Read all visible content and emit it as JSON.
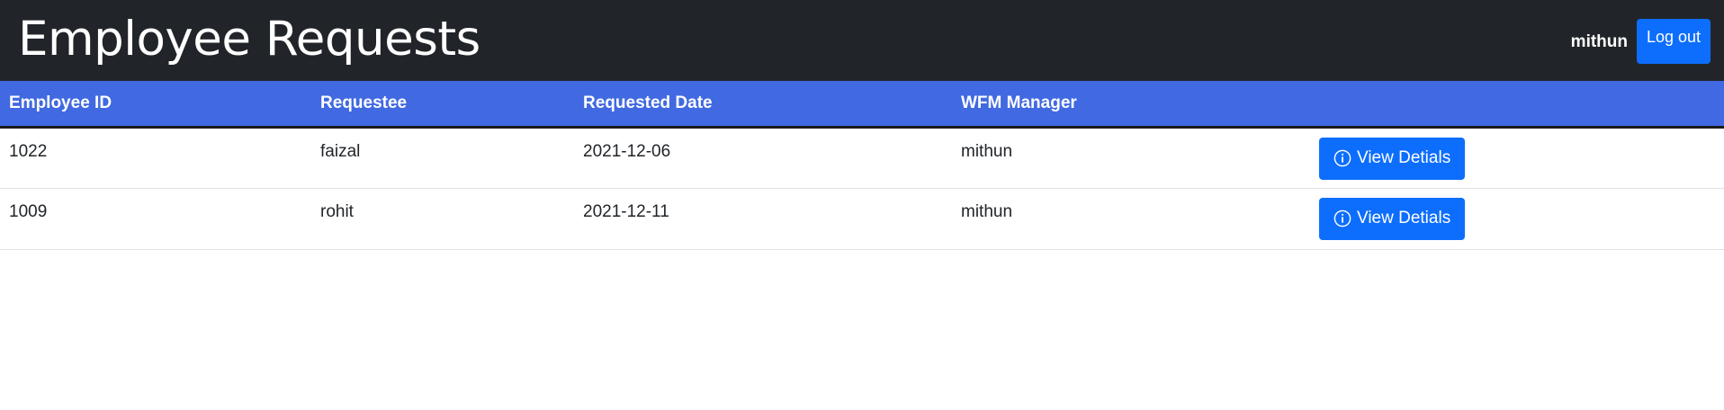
{
  "header": {
    "title": "Employee Requests",
    "username": "mithun",
    "logout_label": "Log out"
  },
  "table": {
    "columns": [
      "Employee ID",
      "Requestee",
      "Requested Date",
      "WFM Manager",
      ""
    ],
    "rows": [
      {
        "employee_id": "1022",
        "requestee": "faizal",
        "requested_date": "2021-12-06",
        "wfm_manager": "mithun",
        "action_label": "View Detials"
      },
      {
        "employee_id": "1009",
        "requestee": "rohit",
        "requested_date": "2021-12-11",
        "wfm_manager": "mithun",
        "action_label": "View Detials"
      }
    ]
  },
  "icons": {
    "view_details_icon": "info-circle-icon"
  },
  "colors": {
    "header_bg": "#212529",
    "table_header_bg": "#4169e1",
    "primary_button": "#0d6efd"
  }
}
